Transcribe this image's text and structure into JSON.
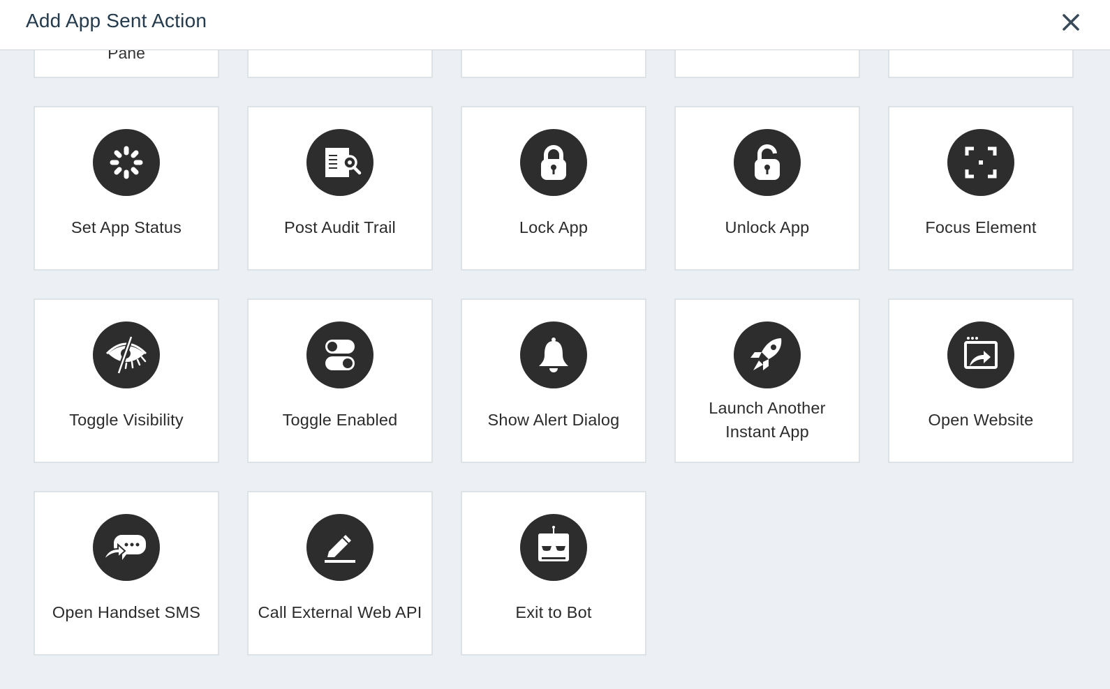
{
  "dialog": {
    "title": "Add App Sent Action",
    "close_label": "Close"
  },
  "colors": {
    "background": "#ecf0f4",
    "tile": "#ffffff",
    "icon_circle": "#2d2d2d",
    "title_text": "#243b4e"
  },
  "partial_row": {
    "labels": [
      "Pane",
      "",
      "",
      "",
      ""
    ]
  },
  "actions": [
    {
      "label": "Set App Status",
      "icon": "spinner-icon"
    },
    {
      "label": "Post Audit Trail",
      "icon": "document-search-icon"
    },
    {
      "label": "Lock App",
      "icon": "lock-icon"
    },
    {
      "label": "Unlock App",
      "icon": "unlock-icon"
    },
    {
      "label": "Focus Element",
      "icon": "focus-frame-icon"
    },
    {
      "label": "Toggle Visibility",
      "icon": "eye-slash-icon"
    },
    {
      "label": "Toggle Enabled",
      "icon": "toggle-switches-icon"
    },
    {
      "label": "Show Alert Dialog",
      "icon": "bell-icon"
    },
    {
      "label": "Launch Another\nInstant App",
      "icon": "rocket-icon"
    },
    {
      "label": "Open Website",
      "icon": "browser-window-arrow-icon"
    },
    {
      "label": "Open Handset SMS",
      "icon": "chat-bubble-arrow-icon"
    },
    {
      "label": "Call External Web API",
      "icon": "pencil-icon"
    },
    {
      "label": "Exit to Bot",
      "icon": "robot-icon"
    }
  ]
}
